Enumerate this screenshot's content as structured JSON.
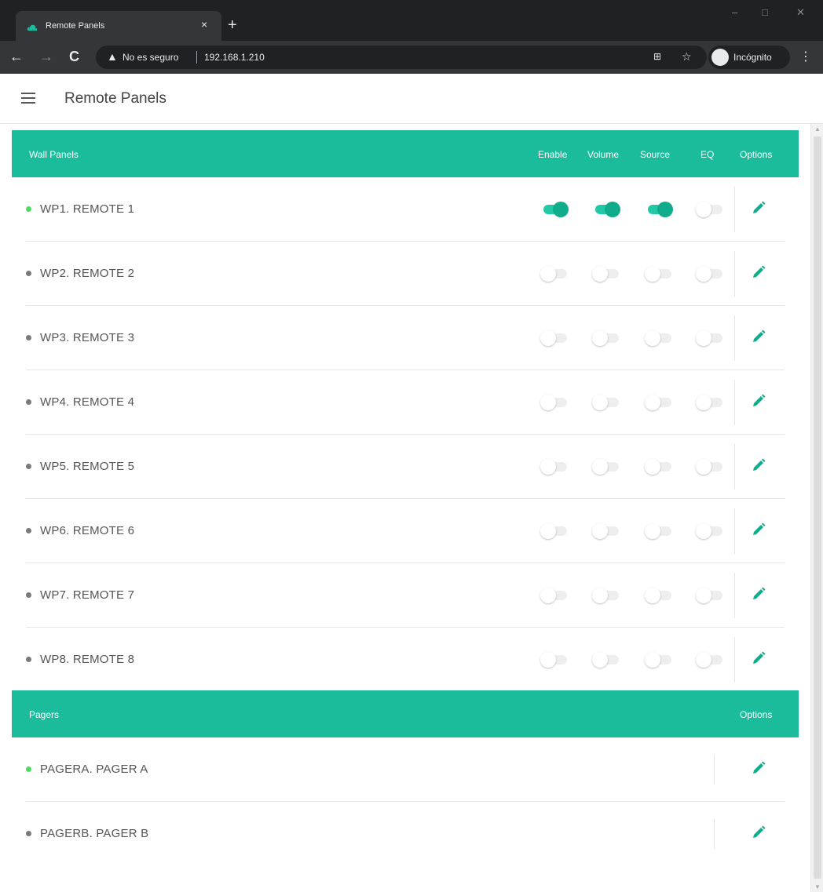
{
  "browser": {
    "tab_title": "Remote Panels",
    "tab_close": "×",
    "new_tab": "+",
    "security_text": "No es seguro",
    "url": "192.168.1.210",
    "incognito_label": "Incógnito",
    "window_minimize": "–",
    "window_maximize": "□",
    "window_close": "✕"
  },
  "app": {
    "title": "Remote Panels"
  },
  "colors": {
    "accent": "#1bbc9b",
    "toggle_on": "#11ac8b",
    "status_active": "#4cd964",
    "status_inactive": "#7a7a7a"
  },
  "wall_panels": {
    "title": "Wall Panels",
    "columns": [
      "Enable",
      "Volume",
      "Source",
      "EQ",
      "Options"
    ],
    "rows": [
      {
        "label": "WP1. REMOTE 1",
        "active": true,
        "enable": true,
        "volume": true,
        "source": true,
        "eq": false
      },
      {
        "label": "WP2. REMOTE 2",
        "active": false,
        "enable": false,
        "volume": false,
        "source": false,
        "eq": false
      },
      {
        "label": "WP3. REMOTE 3",
        "active": false,
        "enable": false,
        "volume": false,
        "source": false,
        "eq": false
      },
      {
        "label": "WP4. REMOTE 4",
        "active": false,
        "enable": false,
        "volume": false,
        "source": false,
        "eq": false
      },
      {
        "label": "WP5. REMOTE 5",
        "active": false,
        "enable": false,
        "volume": false,
        "source": false,
        "eq": false
      },
      {
        "label": "WP6. REMOTE 6",
        "active": false,
        "enable": false,
        "volume": false,
        "source": false,
        "eq": false
      },
      {
        "label": "WP7. REMOTE 7",
        "active": false,
        "enable": false,
        "volume": false,
        "source": false,
        "eq": false
      },
      {
        "label": "WP8. REMOTE 8",
        "active": false,
        "enable": false,
        "volume": false,
        "source": false,
        "eq": false
      }
    ]
  },
  "pagers": {
    "title": "Pagers",
    "columns": [
      "Options"
    ],
    "rows": [
      {
        "label": "PAGERA. PAGER A",
        "active": true
      },
      {
        "label": "PAGERB. PAGER B",
        "active": false
      }
    ]
  }
}
